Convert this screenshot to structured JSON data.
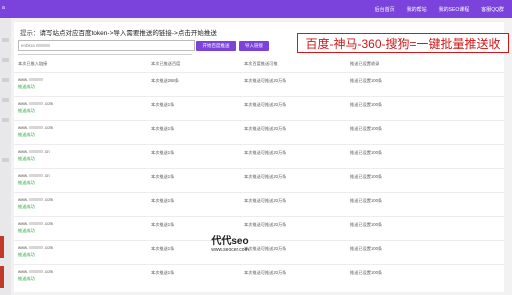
{
  "header": {
    "brand": "a",
    "nav": [
      "后台首页",
      "我的帮站",
      "我的SEO课程",
      "客服QQ群"
    ]
  },
  "hint": {
    "prefix": "提示：",
    "text": "请写站点对应百度token->导入需要推送的链接->点击开始推送"
  },
  "token_input": {
    "value": "enbkra"
  },
  "buttons": {
    "start": "开始百度推送",
    "import": "导入链接"
  },
  "promo": "百度-神马-360-搜狗=一键批量推送收",
  "table": {
    "headers": [
      "本次已推入链接",
      "本次已推送百度",
      "本次百度推送可推",
      "推送已设置收录"
    ],
    "rows": [
      {
        "url": "www.",
        "suffix": "",
        "status": "推送成功",
        "c2": "本次推送288条",
        "c3": "本次推送可推送20万条",
        "c4": "推送已设置100条"
      },
      {
        "url": "www.",
        "suffix": ".com",
        "status": "推送成功",
        "c2": "本次推送1条",
        "c3": "本次推送可推送20万条",
        "c4": "推送已设置100条"
      },
      {
        "url": "www.",
        "suffix": ".com",
        "status": "推送成功",
        "c2": "本次推送1条",
        "c3": "本次推送可推送20万条",
        "c4": "推送已设置100条"
      },
      {
        "url": "www.",
        "suffix": ".cn",
        "status": "推送成功",
        "c2": "本次推送1条",
        "c3": "本次推送可推送20万条",
        "c4": "推送已设置100条"
      },
      {
        "url": "www.",
        "suffix": ".cn",
        "status": "推送成功",
        "c2": "本次推送1条",
        "c3": "本次推送可推送20万条",
        "c4": "推送已设置100条"
      },
      {
        "url": "www.",
        "suffix": ".com",
        "status": "推送成功",
        "c2": "本次推送1条",
        "c3": "本次推送可推送20万条",
        "c4": "推送已设置100条"
      },
      {
        "url": "www.",
        "suffix": ".com",
        "status": "推送成功",
        "c2": "本次推送1条",
        "c3": "本次推送可推送20万条",
        "c4": "推送已设置100条"
      },
      {
        "url": "www.",
        "suffix": ".com",
        "status": "推送成功",
        "c2": "本次推送1条",
        "c3": "本次推送可推送20万条",
        "c4": "推送已设置100条"
      },
      {
        "url": "www.",
        "suffix": ".com",
        "status": "推送成功",
        "c2": "本次推送1条",
        "c3": "本次推送可推送20万条",
        "c4": "推送已设置100条"
      }
    ]
  },
  "watermark": {
    "title": "代代seo",
    "url": "www.seocer.com"
  },
  "colors": {
    "accent": "#7b43dc",
    "promo_red": "#d01818",
    "status_green": "#2e9e3e"
  }
}
